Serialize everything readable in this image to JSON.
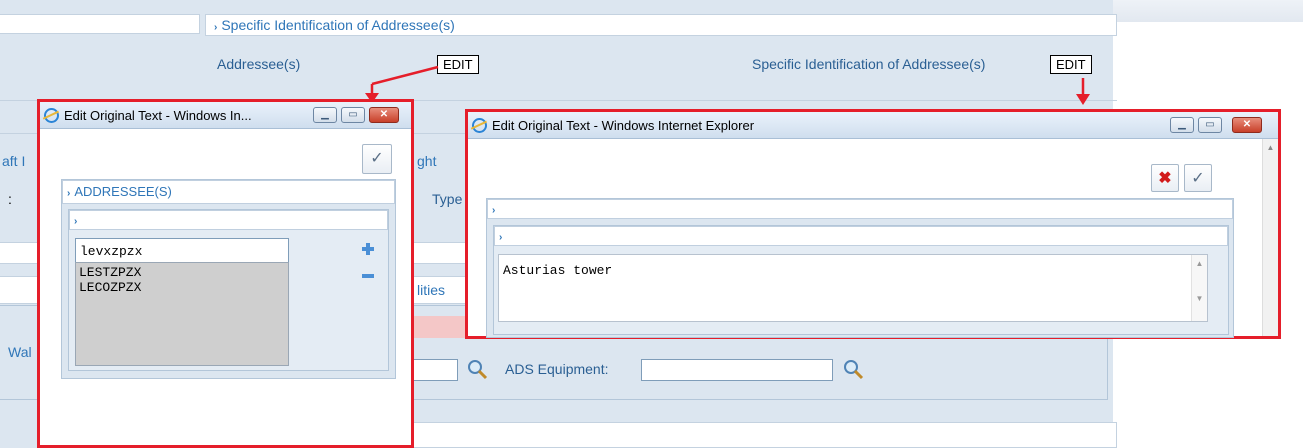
{
  "background": {
    "section_title": "Specific Identification of Addressee(s)",
    "addressees_label": "Addressee(s)",
    "edit_button_1": "EDIT",
    "specific_label": "Specific Identification of Addressee(s)",
    "edit_button_2": "EDIT",
    "partial_aircraft": "aft I",
    "partial_flight": "ght",
    "partial_colon": ":",
    "partial_type": "Type",
    "partial_capabilities": "lities",
    "partial_wake": "Wal",
    "ads_equipment_label": "ADS Equipment:",
    "ads_equipment_value": ""
  },
  "dialog_left": {
    "title": "Edit Original Text - Windows In...",
    "section_header": "ADDRESSEE(S)",
    "input_value": "levxzpzx",
    "list_items": [
      "LESTZPZX",
      "LECOZPZX"
    ]
  },
  "dialog_right": {
    "title": "Edit Original Text - Windows Internet Explorer",
    "textarea_value": "Asturias tower"
  },
  "colors": {
    "highlight_border": "#e51e2a",
    "link": "#2f76b8",
    "panel": "#dce6f0"
  }
}
